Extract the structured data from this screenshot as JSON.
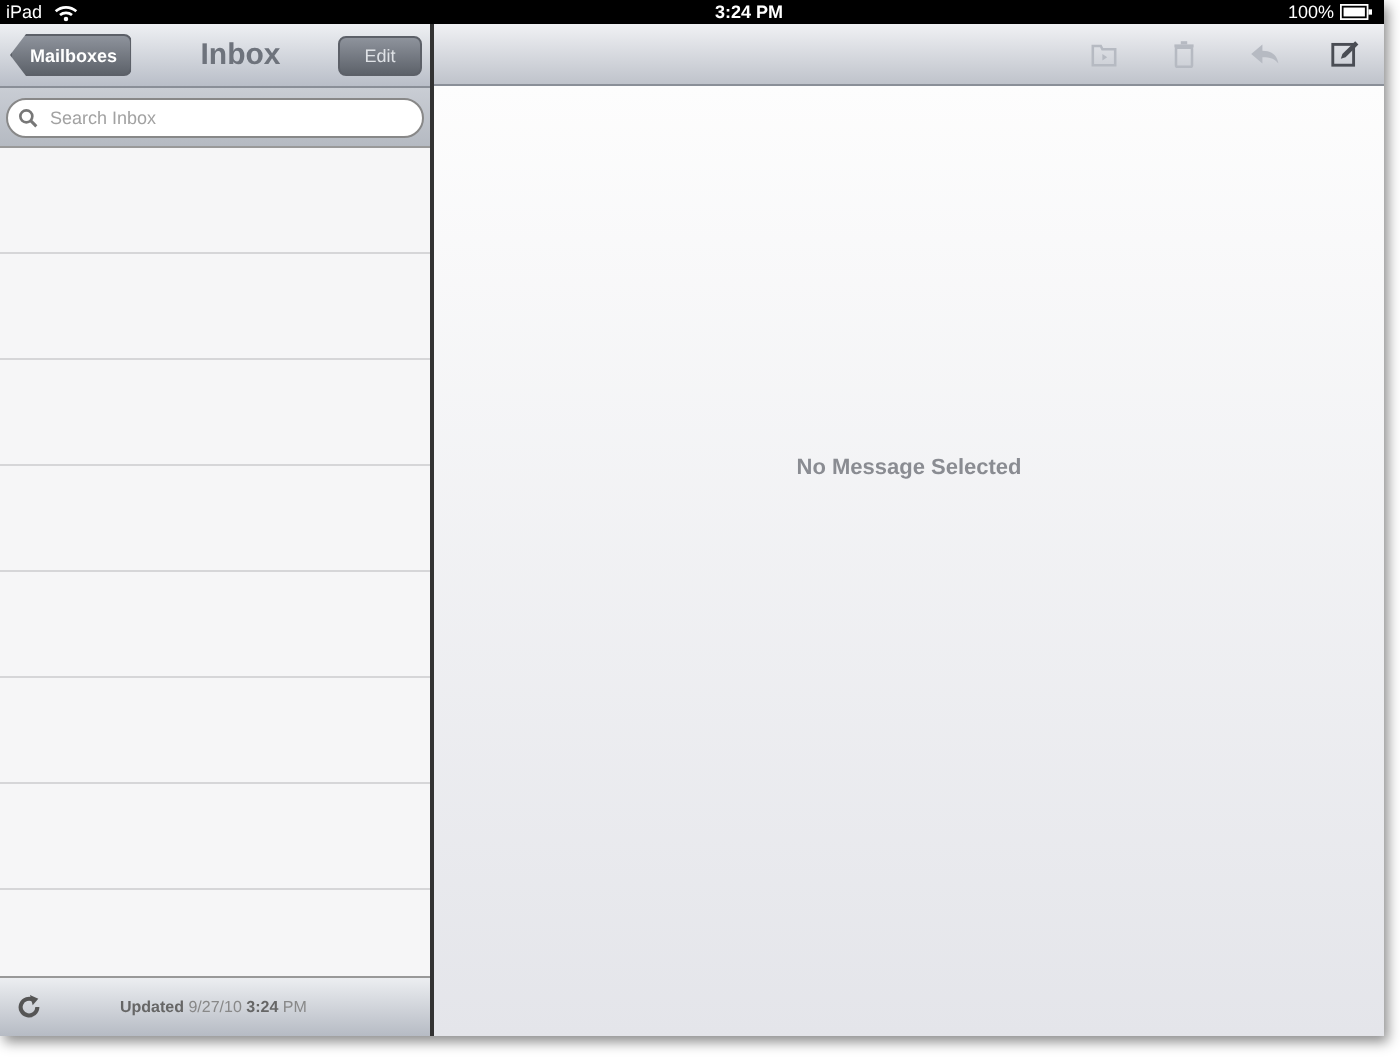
{
  "status_bar": {
    "device": "iPad",
    "time": "3:24 PM",
    "battery_text": "100%"
  },
  "sidebar": {
    "back_button": "Mailboxes",
    "title": "Inbox",
    "edit_button": "Edit",
    "search": {
      "placeholder": "Search Inbox"
    },
    "footer": {
      "updated": "**Updated** 9/27/10 **3:24** PM"
    }
  },
  "toolbar": {
    "buttons": [
      {
        "kind": "move",
        "disabled": true
      },
      {
        "kind": "trash",
        "disabled": true
      },
      {
        "kind": "reply",
        "disabled": true
      },
      {
        "kind": "compose",
        "disabled": false
      }
    ]
  },
  "detail": {
    "message": "No Message Selected"
  }
}
